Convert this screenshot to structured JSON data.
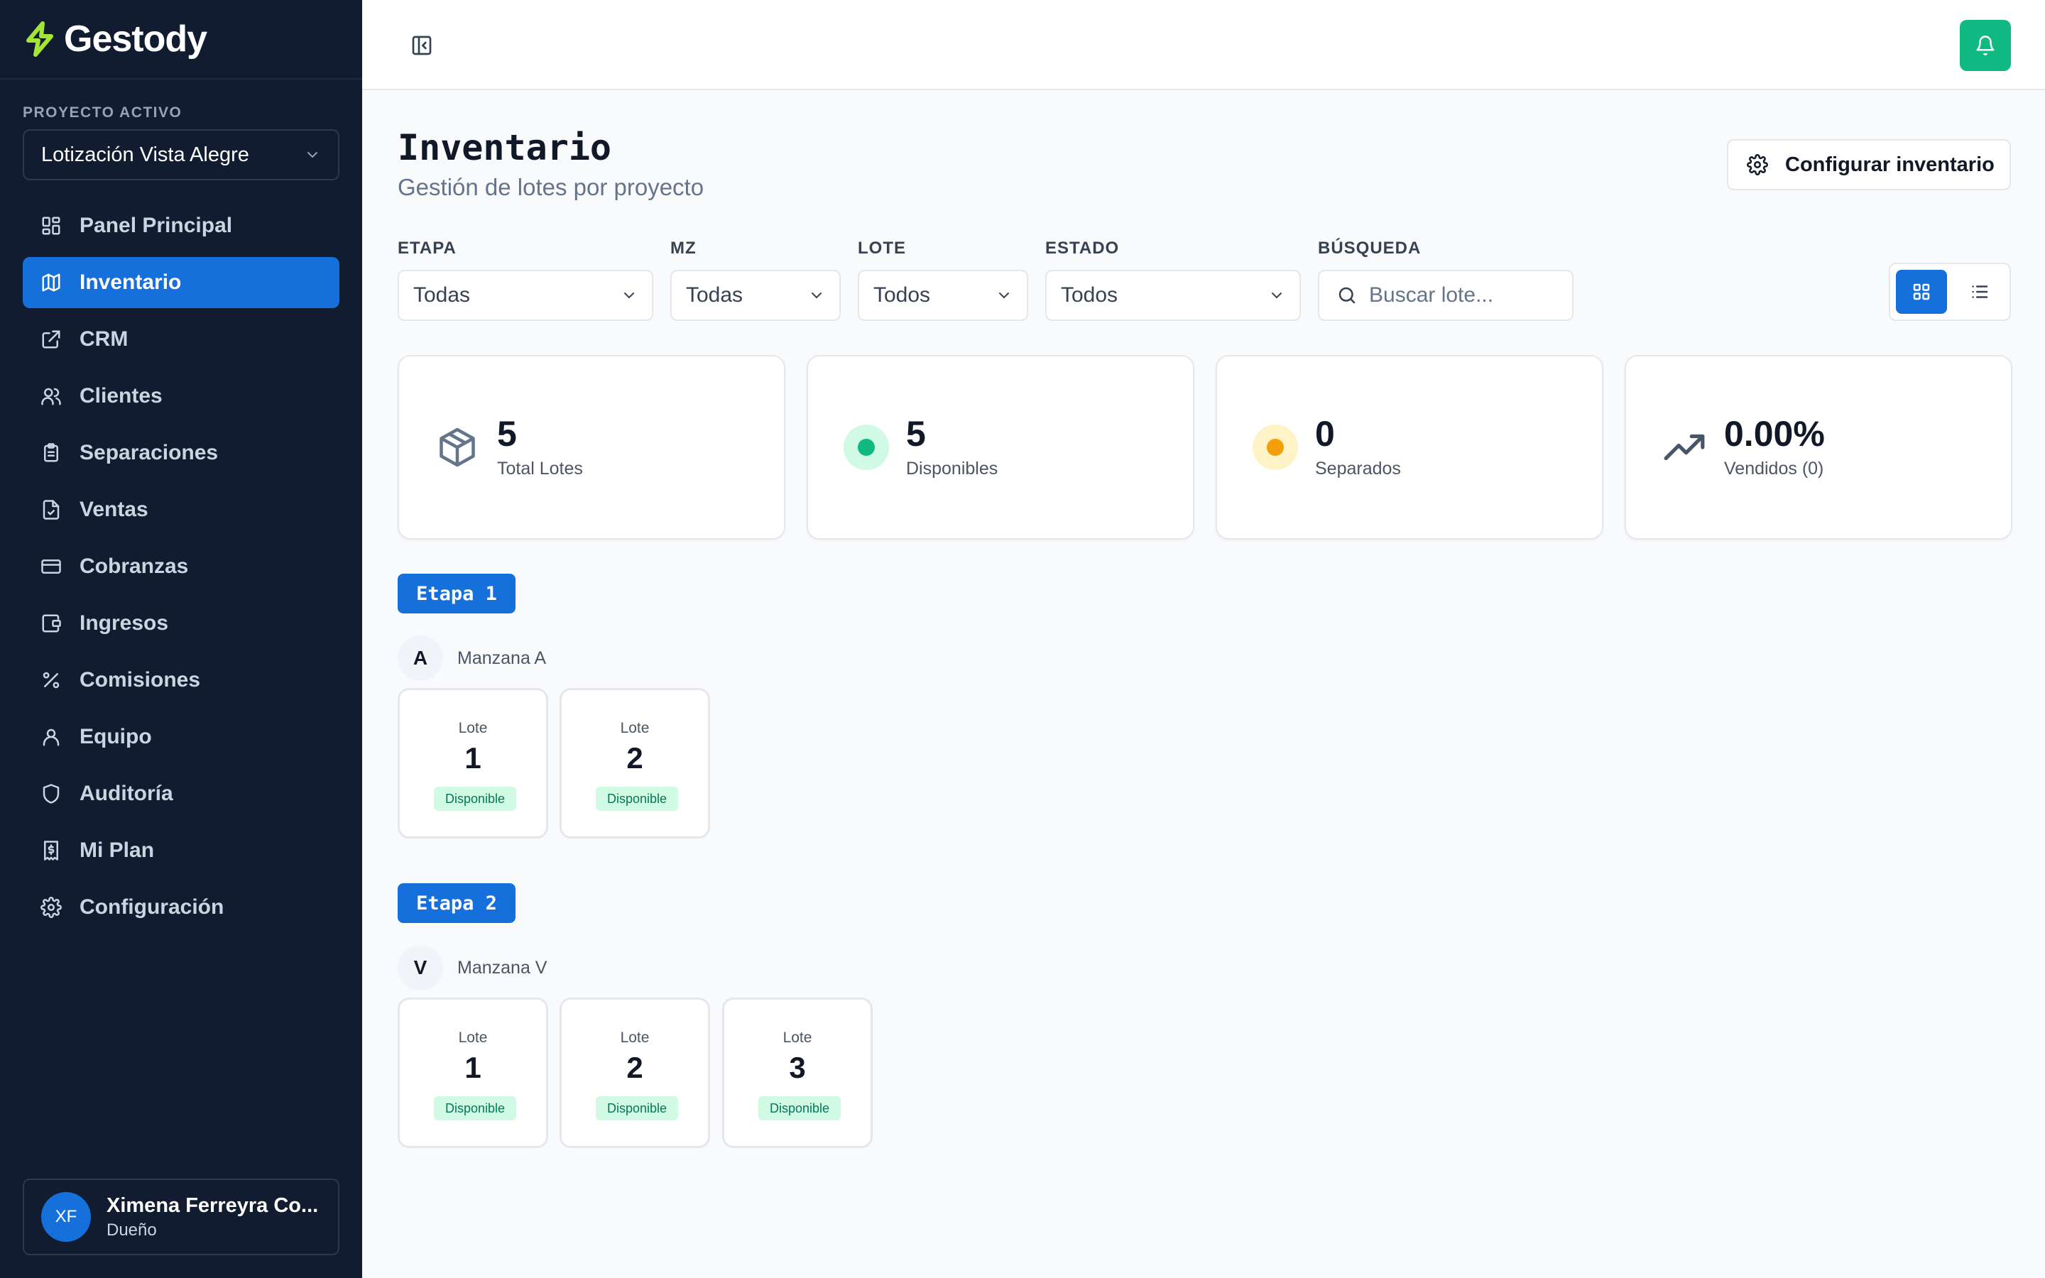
{
  "brand": {
    "name": "Gestody",
    "color": "#a3e635"
  },
  "sidebar": {
    "project_label": "PROYECTO ACTIVO",
    "project_value": "Lotización Vista Alegre",
    "items": [
      {
        "label": "Panel Principal",
        "icon": "layout-grid-icon"
      },
      {
        "label": "Inventario",
        "icon": "map-icon",
        "active": true
      },
      {
        "label": "CRM",
        "icon": "external-link-icon"
      },
      {
        "label": "Clientes",
        "icon": "users-icon"
      },
      {
        "label": "Separaciones",
        "icon": "clipboard-icon"
      },
      {
        "label": "Ventas",
        "icon": "file-check-icon"
      },
      {
        "label": "Cobranzas",
        "icon": "credit-card-icon"
      },
      {
        "label": "Ingresos",
        "icon": "wallet-icon"
      },
      {
        "label": "Comisiones",
        "icon": "percent-icon"
      },
      {
        "label": "Equipo",
        "icon": "user-icon"
      },
      {
        "label": "Auditoría",
        "icon": "shield-icon"
      },
      {
        "label": "Mi Plan",
        "icon": "receipt-icon"
      },
      {
        "label": "Configuración",
        "icon": "gear-icon"
      }
    ],
    "user": {
      "initials": "XF",
      "name": "Ximena Ferreyra Co...",
      "role": "Dueño"
    }
  },
  "header": {
    "title": "Inventario",
    "subtitle": "Gestión de lotes por proyecto",
    "config_label": "Configurar inventario"
  },
  "filters": {
    "etapa": {
      "label": "ETAPA",
      "value": "Todas"
    },
    "mz": {
      "label": "MZ",
      "value": "Todas"
    },
    "lote": {
      "label": "LOTE",
      "value": "Todos"
    },
    "estado": {
      "label": "ESTADO",
      "value": "Todos"
    },
    "busqueda": {
      "label": "BÚSQUEDA",
      "placeholder": "Buscar lote..."
    }
  },
  "stats": [
    {
      "value": "5",
      "label": "Total Lotes",
      "icon": "package-icon"
    },
    {
      "value": "5",
      "label": "Disponibles",
      "icon": "green-dot-icon"
    },
    {
      "value": "0",
      "label": "Separados",
      "icon": "orange-dot-icon"
    },
    {
      "value": "0.00%",
      "label": "Vendidos (0)",
      "icon": "trending-up-icon"
    }
  ],
  "etapas": [
    {
      "label": "Etapa 1",
      "manzana": {
        "letter": "A",
        "name": "Manzana A"
      },
      "lotes": [
        {
          "label": "Lote",
          "number": "1",
          "status": "Disponible"
        },
        {
          "label": "Lote",
          "number": "2",
          "status": "Disponible"
        }
      ]
    },
    {
      "label": "Etapa 2",
      "manzana": {
        "letter": "V",
        "name": "Manzana V"
      },
      "lotes": [
        {
          "label": "Lote",
          "number": "1",
          "status": "Disponible"
        },
        {
          "label": "Lote",
          "number": "2",
          "status": "Disponible"
        },
        {
          "label": "Lote",
          "number": "3",
          "status": "Disponible"
        }
      ]
    }
  ],
  "colors": {
    "sidebar_bg": "#111c31",
    "primary": "#1570db",
    "success": "#10b981",
    "warning": "#f59e0b"
  }
}
